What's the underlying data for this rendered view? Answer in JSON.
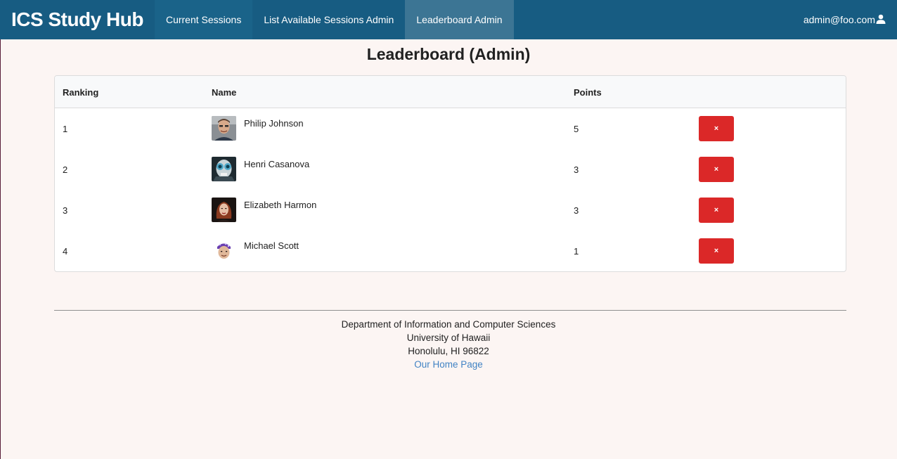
{
  "navbar": {
    "brand": "ICS Study Hub",
    "items": [
      {
        "label": "Current Sessions",
        "active": false
      },
      {
        "label": "List Available Sessions Admin",
        "active": false
      },
      {
        "label": "Leaderboard Admin",
        "active": true
      }
    ],
    "user_email": "admin@foo.com",
    "user_icon": "user-icon"
  },
  "page": {
    "title": "Leaderboard (Admin)"
  },
  "table": {
    "headers": [
      "Ranking",
      "Name",
      "Points"
    ],
    "rows": [
      {
        "ranking": "1",
        "name": "Philip Johnson",
        "points": "5",
        "delete_label": "×"
      },
      {
        "ranking": "2",
        "name": "Henri Casanova",
        "points": "3",
        "delete_label": "×"
      },
      {
        "ranking": "3",
        "name": "Elizabeth Harmon",
        "points": "3",
        "delete_label": "×"
      },
      {
        "ranking": "4",
        "name": "Michael Scott",
        "points": "1",
        "delete_label": "×"
      }
    ]
  },
  "footer": {
    "line1": "Department of Information and Computer Sciences",
    "line2": "University of Hawaii",
    "line3": "Honolulu, HI 96822",
    "link_label": "Our Home Page"
  },
  "colors": {
    "navbar": "#175c82",
    "navbar_active": "#3c7594",
    "delete_button": "#db2828",
    "link": "#4183c4",
    "background": "#fcf5f3"
  }
}
